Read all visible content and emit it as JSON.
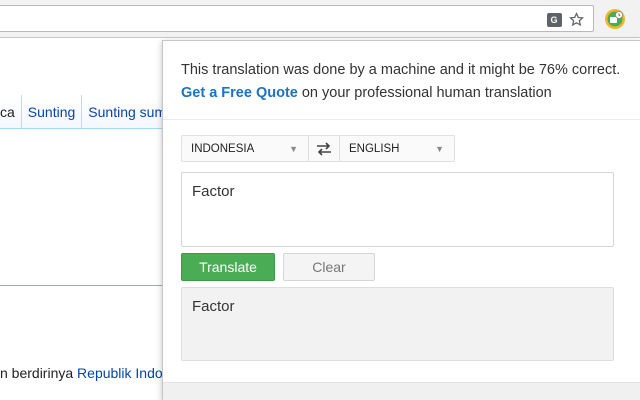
{
  "browser": {
    "icons": {
      "translate": "translate-icon",
      "star": "star-icon",
      "extension": "translator-extension-icon"
    },
    "translate_glyph": "G"
  },
  "page": {
    "tabs": [
      {
        "label": "ca"
      },
      {
        "label": "Sunting"
      },
      {
        "label": "Sunting sumbe"
      }
    ],
    "paragraph": {
      "before_link": "n berdirinya ",
      "link": "Republik Indo"
    }
  },
  "popup": {
    "notice": {
      "text": "This translation was done by a machine and it might be 76% correct. ",
      "link": "Get a Free Quote",
      "suffix": " on your professional human translation"
    },
    "source_language": "INDONESIA",
    "target_language": "ENGLISH",
    "input_text": "Factor",
    "translate_label": "Translate",
    "clear_label": "Clear",
    "output_text": "Factor",
    "colors": {
      "translate_button": "#4aac55",
      "quote_link": "#1a73c8"
    }
  }
}
